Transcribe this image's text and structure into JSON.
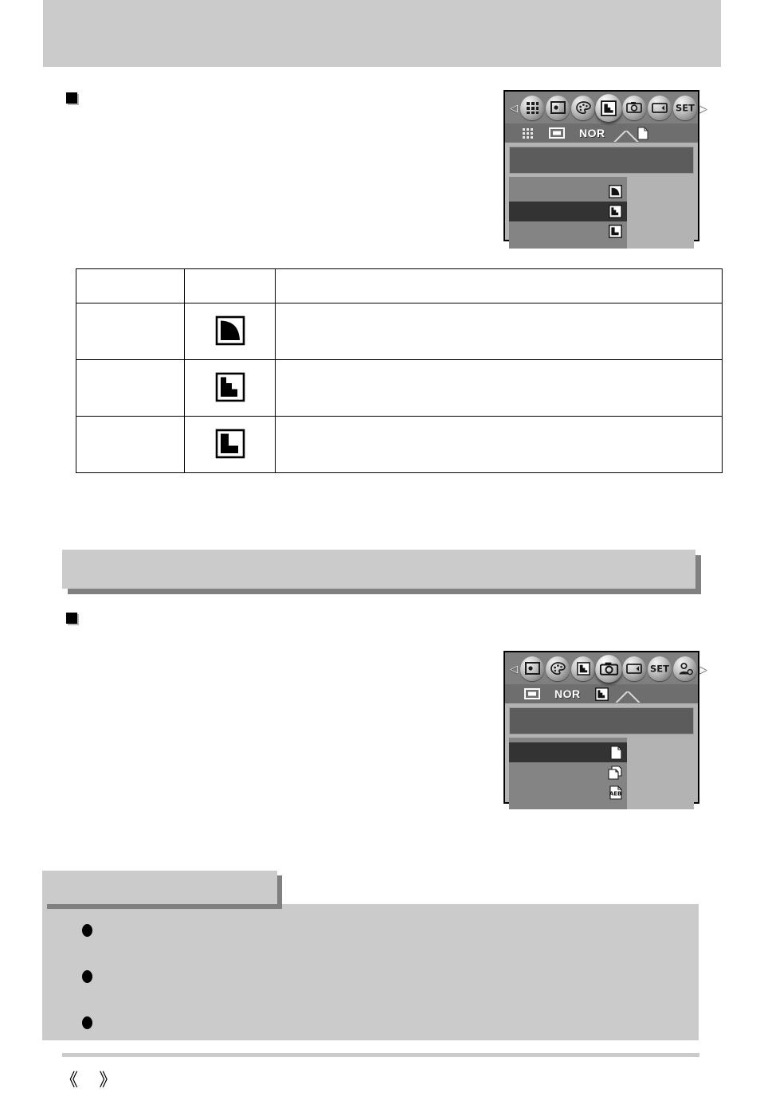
{
  "page": {
    "header_title": "",
    "footer_page_label": "《   》",
    "footer_page_number": ""
  },
  "sections": [
    {
      "id": "sharpness",
      "bullet_label": "",
      "lcd": {
        "name": "sharpness-menu",
        "left_arrow": "◁",
        "right_arrow": "▷",
        "tabs": [
          {
            "icon": "grid-thumbnail-icon",
            "selected": false
          },
          {
            "icon": "image-size-icon",
            "selected": false
          },
          {
            "icon": "palette-effect-icon",
            "selected": false
          },
          {
            "icon": "sharpness-icon",
            "selected": true
          },
          {
            "icon": "camera-shooting-icon",
            "selected": false
          },
          {
            "icon": "lcd-display-icon",
            "selected": false
          },
          {
            "icon": "set-setup-icon",
            "selected": false
          }
        ],
        "subtabs": [
          {
            "icon": "dotted-grid-icon",
            "label": ""
          },
          {
            "icon": "image-size-icon",
            "label": ""
          },
          {
            "icon": "quality-text",
            "label": "NOR"
          },
          {
            "icon": "sharpness-icon",
            "label": "",
            "selected": true
          },
          {
            "icon": "single-page-icon",
            "label": ""
          }
        ],
        "title_band_text": "",
        "options": [
          {
            "label": "",
            "icon": "sharpness-soft-icon",
            "selected": false
          },
          {
            "label": "",
            "icon": "sharpness-normal-icon",
            "selected": true
          },
          {
            "label": "",
            "icon": "sharpness-vivid-icon",
            "selected": false
          }
        ]
      },
      "table": {
        "headers": [
          "",
          "",
          ""
        ],
        "rows": [
          {
            "mode": "",
            "icon": "sharpness-soft-icon",
            "description": ""
          },
          {
            "mode": "",
            "icon": "sharpness-normal-icon",
            "description": ""
          },
          {
            "mode": "",
            "icon": "sharpness-vivid-icon",
            "description": ""
          }
        ]
      }
    },
    {
      "id": "continuous-shot",
      "section_bar_label": "",
      "bullet_label": "",
      "lcd": {
        "name": "shooting-mode-menu",
        "left_arrow": "◁",
        "right_arrow": "▷",
        "tabs": [
          {
            "icon": "image-size-icon",
            "selected": false
          },
          {
            "icon": "palette-effect-icon",
            "selected": false
          },
          {
            "icon": "sharpness-icon",
            "selected": false
          },
          {
            "icon": "camera-shooting-icon",
            "selected": true
          },
          {
            "icon": "lcd-display-icon",
            "selected": false
          },
          {
            "icon": "set-setup-icon",
            "selected": false
          },
          {
            "icon": "user-profile-icon",
            "selected": false
          }
        ],
        "subtabs": [
          {
            "icon": "image-size-icon",
            "label": ""
          },
          {
            "icon": "quality-text",
            "label": "NOR"
          },
          {
            "icon": "sharpness-icon",
            "label": ""
          },
          {
            "icon": "camera-shooting-icon",
            "label": "",
            "selected": true
          }
        ],
        "title_band_text": "",
        "options": [
          {
            "label": "",
            "icon": "single-shot-icon",
            "selected": true
          },
          {
            "label": "",
            "icon": "continuous-shot-icon",
            "selected": false
          },
          {
            "label": "",
            "icon": "aeb-icon",
            "selected": false
          }
        ]
      }
    }
  ],
  "information": {
    "tab_label": "",
    "items": [
      {
        "bullet": "dot-bullet",
        "text": ""
      },
      {
        "bullet": "dot-bullet",
        "text": ""
      },
      {
        "bullet": "dot-bullet",
        "text": ""
      }
    ]
  },
  "colors": {
    "band_gray": "#cbcbcb",
    "shadow_gray": "#808080",
    "lcd_bg": "#b3b3b3",
    "lcd_tabbar": "#7f7f7f",
    "lcd_subbar": "#6e6e6e",
    "lcd_title_band": "#5c5c5c",
    "lcd_list_bg": "#848484",
    "lcd_active_row": "#333333",
    "ink": "#000000"
  }
}
